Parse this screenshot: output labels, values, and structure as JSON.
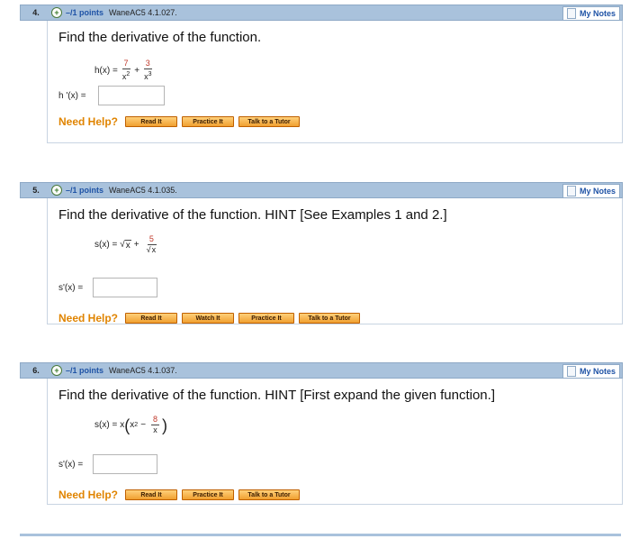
{
  "questions": [
    {
      "number": "4.",
      "points": "–/1 points",
      "source": "WaneAC5 4.1.027.",
      "my_notes": "My Notes",
      "prompt": "Find the derivative of the function.",
      "function": {
        "lhs": "h(x) =",
        "frac1_num": "7",
        "frac1_den": "x",
        "frac1_den_exp": "2",
        "plus": "+",
        "frac2_num": "3",
        "frac2_den": "x",
        "frac2_den_exp": "3"
      },
      "answer_label": "h '(x) =",
      "answer_value": "",
      "need_help": "Need Help?",
      "help_buttons": [
        "Read It",
        "Practice It",
        "Talk to a Tutor"
      ]
    },
    {
      "number": "5.",
      "points": "–/1 points",
      "source": "WaneAC5 4.1.035.",
      "my_notes": "My Notes",
      "prompt": "Find the derivative of the function. HINT [See Examples 1 and 2.]",
      "function": {
        "lhs": "s(x) =",
        "sqrt_sym": "√",
        "sqrt_arg": "x",
        "plus": "+",
        "frac_num": "5",
        "frac_den_sqrt": "√",
        "frac_den": "x"
      },
      "answer_label": "s'(x) =",
      "answer_value": "",
      "need_help": "Need Help?",
      "help_buttons": [
        "Read It",
        "Watch It",
        "Practice It",
        "Talk to a Tutor"
      ]
    },
    {
      "number": "6.",
      "points": "–/1 points",
      "source": "WaneAC5 4.1.037.",
      "my_notes": "My Notes",
      "prompt": "Find the derivative of the function. HINT [First expand the given function.]",
      "function": {
        "lhs": "s(x) =",
        "x": "x",
        "open": "(",
        "x2": "x",
        "exp": "2",
        "minus": "−",
        "frac_num": "8",
        "frac_den": "x",
        "close": ")"
      },
      "answer_label": "s'(x) =",
      "answer_value": "",
      "need_help": "Need Help?",
      "help_buttons": [
        "Read It",
        "Practice It",
        "Talk to a Tutor"
      ]
    }
  ],
  "icons": {
    "expand": "plus-circle-icon",
    "notes": "notes-icon"
  },
  "colors": {
    "header_bg": "#a9c2dc",
    "points_blue": "#1f53a6",
    "help_orange": "#e08400",
    "numerator_red": "#c0392b"
  }
}
